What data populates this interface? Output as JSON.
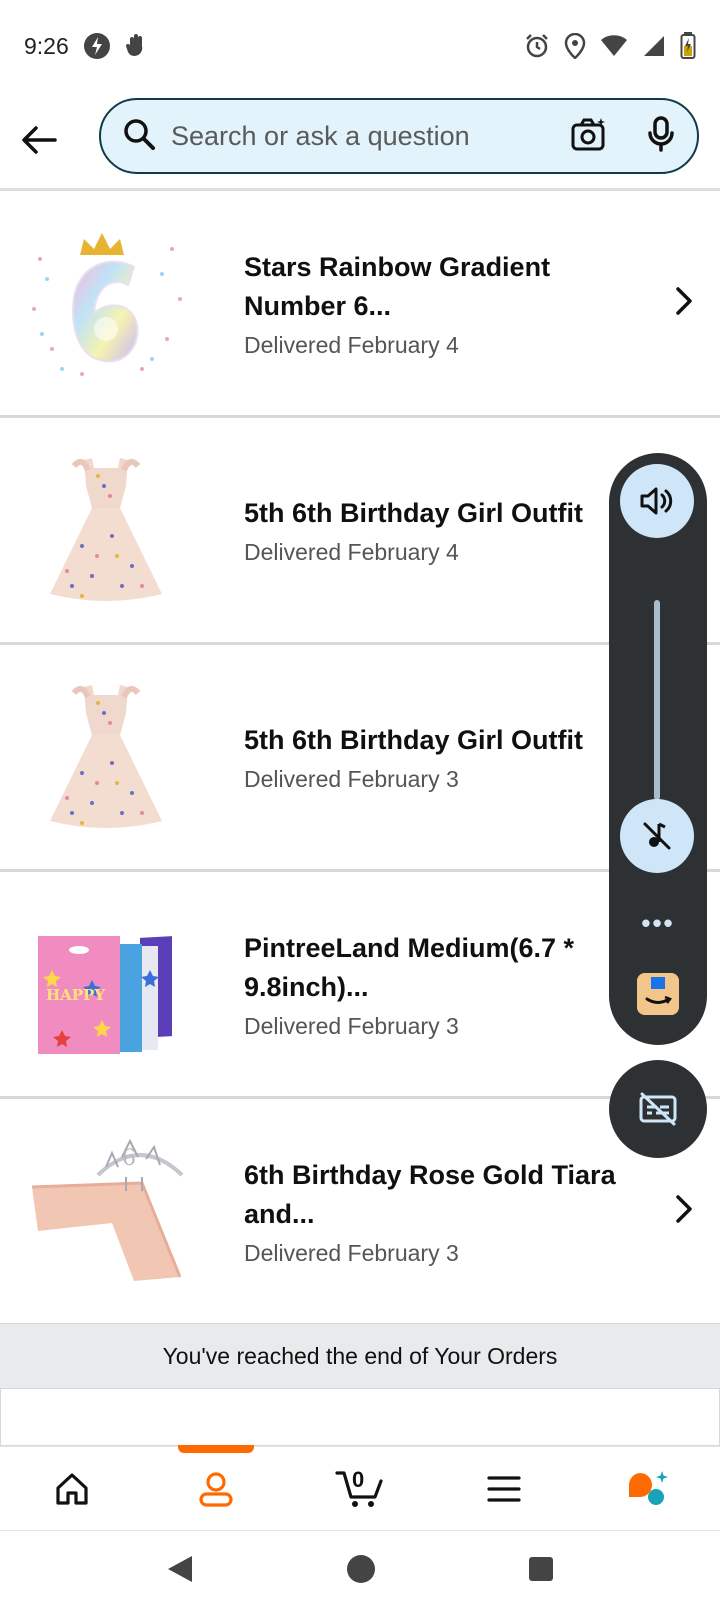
{
  "status_bar": {
    "time": "9:26",
    "icons_left": [
      "data-saver-icon",
      "hand-icon"
    ],
    "icons_right": [
      "alarm-icon",
      "location-icon",
      "wifi-icon",
      "signal-icon",
      "battery-icon"
    ]
  },
  "header": {
    "search_placeholder": "Search or ask a question"
  },
  "orders": [
    {
      "title": "Stars Rainbow Gradient Number 6...",
      "status": "Delivered February 4",
      "image": "number-6-balloon"
    },
    {
      "title": "5th 6th Birthday Girl Outfit",
      "status": "Delivered February 4",
      "image": "girl-dress"
    },
    {
      "title": "5th 6th Birthday Girl Outfit",
      "status": "Delivered February 3",
      "image": "girl-dress"
    },
    {
      "title": "PintreeLand Medium(6.7 * 9.8inch)...",
      "status": "Delivered February 3",
      "image": "party-bags"
    },
    {
      "title": "6th Birthday Rose Gold Tiara and...",
      "status": "Delivered February 3",
      "image": "tiara-sash"
    }
  ],
  "end_message": "You've reached the end of Your Orders",
  "bottom_nav": {
    "items": [
      "home",
      "account",
      "cart",
      "menu",
      "rufus"
    ],
    "cart_count": "0",
    "active": "account"
  },
  "volume_panel": {
    "more_label": "•••"
  },
  "colors": {
    "accent": "#ff6a00",
    "search_bg": "#e3f3fb",
    "panel_bg": "#2e3133",
    "panel_button": "#cfe6f8"
  }
}
